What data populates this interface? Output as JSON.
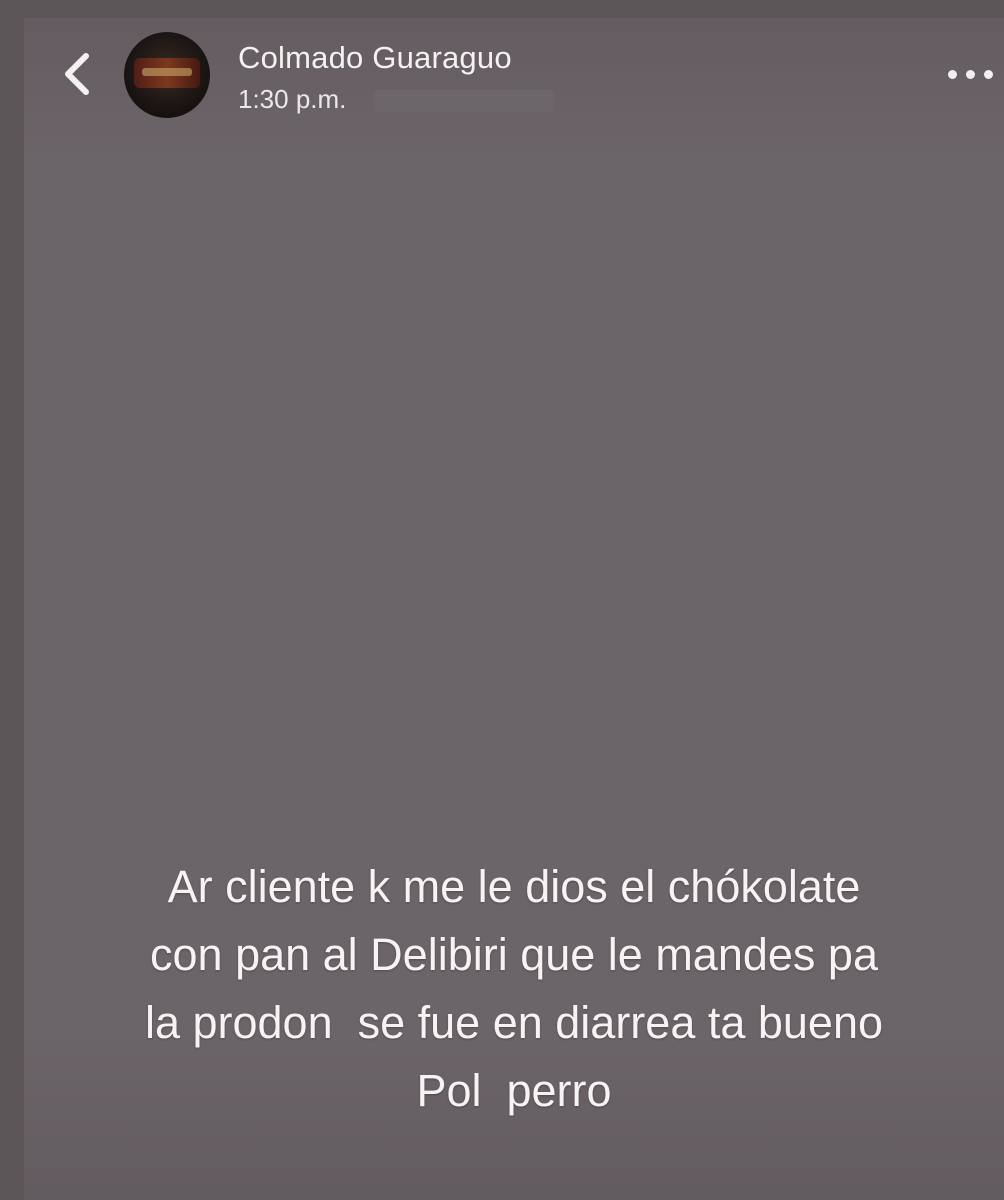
{
  "header": {
    "back_icon": "chevron-left-icon",
    "account_name": "Colmado Guaraguo",
    "timestamp": "1:30 p.m.",
    "more_icon": "more-horizontal-icon"
  },
  "story": {
    "background_color": "#6b6468",
    "caption_lines": [
      "Ar cliente k me le dios el chókolate",
      "con pan al Delibiri que le mandes pa",
      "la prodon  se fue en diarrea ta bueno",
      "Pol  perro"
    ]
  }
}
